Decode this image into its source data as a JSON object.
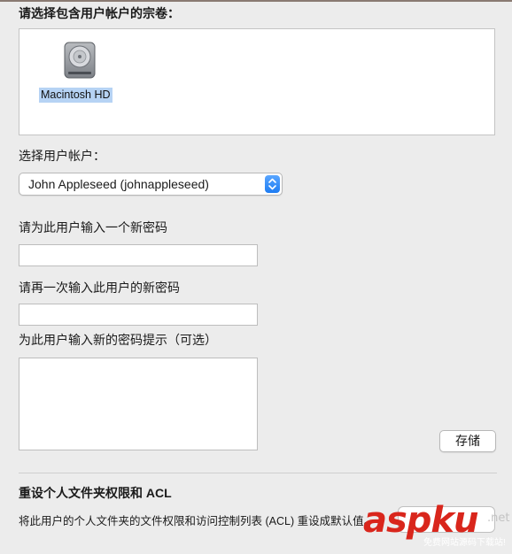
{
  "volume_section": {
    "title": "请选择包含用户帐户的宗卷：",
    "volumes": [
      {
        "name": "Macintosh HD",
        "icon": "hard-disk-icon",
        "selected": true
      }
    ]
  },
  "user_section": {
    "label": "选择用户帐户：",
    "selected_user": "John Appleseed (johnappleseed)",
    "accent_color": "#1d7cf2"
  },
  "password": {
    "new_label": "请为此用户输入一个新密码",
    "new_value": "",
    "confirm_label": "请再一次输入此用户的新密码",
    "confirm_value": "",
    "hint_label": "为此用户输入新的密码提示（可选）",
    "hint_value": ""
  },
  "save_button": "存储",
  "acl_section": {
    "title": "重设个人文件夹权限和 ACL",
    "description": "将此用户的个人文件夹的文件权限和访问控制列表 (ACL) 重设成默认值。"
  },
  "watermark": {
    "brand": "aspku",
    "tld": ".net",
    "tagline": "免费网站源码下载站!"
  }
}
